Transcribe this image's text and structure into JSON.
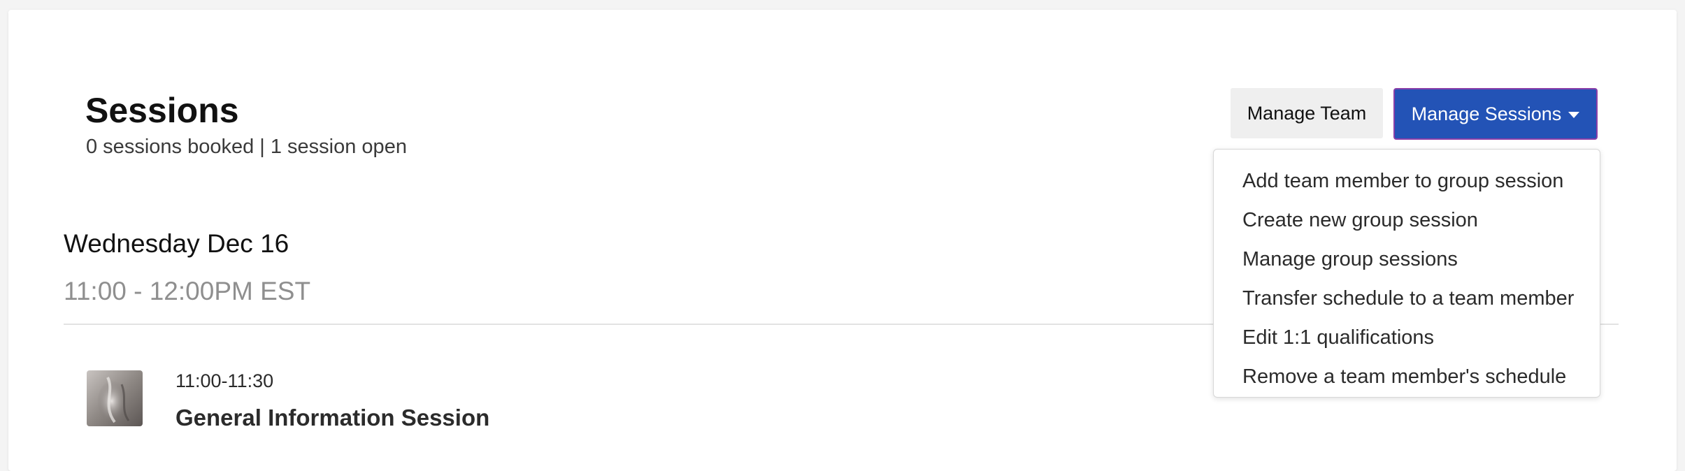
{
  "header": {
    "title": "Sessions",
    "summary": "0 sessions booked | 1 session open"
  },
  "actions": {
    "manage_team_label": "Manage Team",
    "manage_sessions_label": "Manage Sessions",
    "manage_sessions_color": "#2353b6"
  },
  "dropdown": {
    "items": [
      "Add team member to group session",
      "Create new group session",
      "Manage group sessions",
      "Transfer schedule to a team member",
      "Edit 1:1 qualifications",
      "Remove a team member's schedule"
    ]
  },
  "day": {
    "date": "Wednesday Dec 16",
    "time_range": "11:00 - 12:00PM EST"
  },
  "session": {
    "time": "11:00-11:30",
    "name": "General Information Session",
    "thumbnail_icon": "session-thumbnail-image"
  }
}
